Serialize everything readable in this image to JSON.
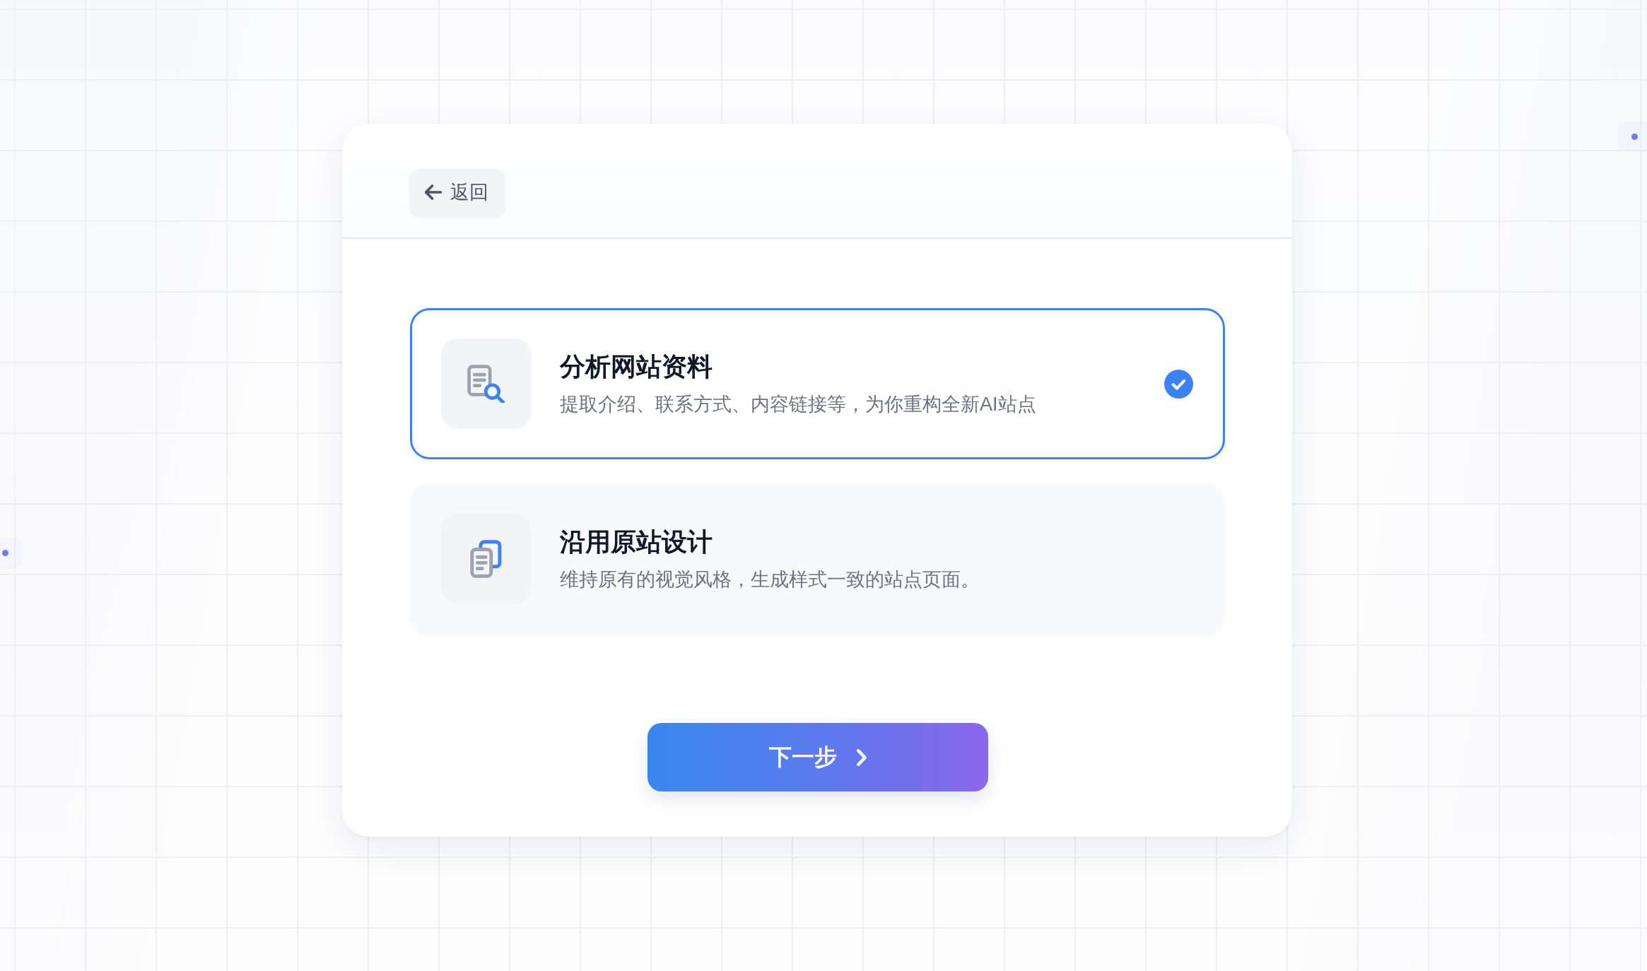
{
  "back_button": {
    "label": "返回"
  },
  "options": [
    {
      "kind": "document-search",
      "title": "分析网站资料",
      "description": "提取介绍、联系方式、内容链接等，为你重构全新AI站点",
      "selected": true
    },
    {
      "kind": "documents",
      "title": "沿用原站设计",
      "description": "维持原有的视觉风格，生成样式一致的站点页面。",
      "selected": false
    }
  ],
  "next_button": {
    "label": "下一步"
  }
}
